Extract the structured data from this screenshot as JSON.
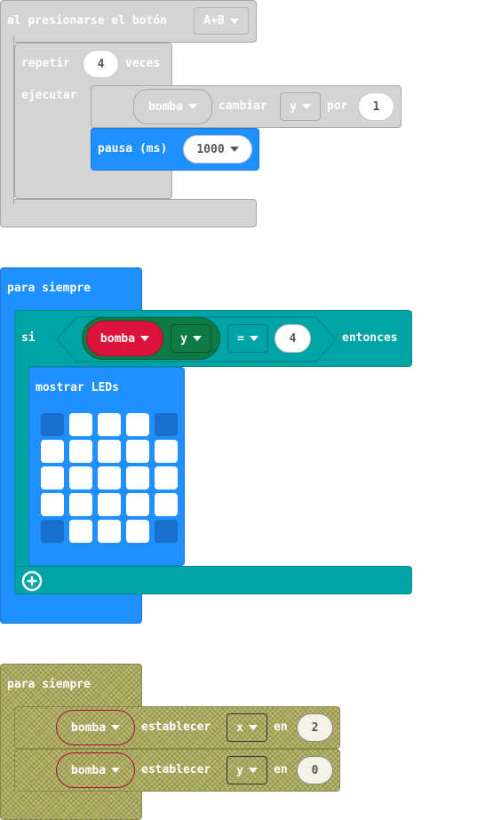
{
  "event_block": {
    "label": "al presionarse el botón",
    "button_value": "A+B",
    "repeat": {
      "label_repeat": "repetir",
      "times": "4",
      "label_times": "veces",
      "label_do": "ejecutar",
      "change": {
        "variable": "bomba",
        "label_change": "cambiar",
        "property": "y",
        "label_by": "por",
        "amount": "1"
      },
      "pause": {
        "label": "pausa (ms)",
        "value": "1000"
      }
    }
  },
  "forever_block_1": {
    "label": "para siempre",
    "if": {
      "label_if": "si",
      "variable": "bomba",
      "property": "y",
      "operator": "=",
      "value": "4",
      "label_then": "entonces"
    },
    "show_leds": {
      "label": "mostrar LEDs",
      "grid": [
        [
          0,
          1,
          1,
          1,
          0
        ],
        [
          1,
          1,
          1,
          1,
          1
        ],
        [
          1,
          1,
          1,
          1,
          1
        ],
        [
          1,
          1,
          1,
          1,
          1
        ],
        [
          0,
          1,
          1,
          1,
          0
        ]
      ]
    },
    "add_icon": "plus-circle-icon"
  },
  "forever_block_2": {
    "label": "para siempre",
    "statements": [
      {
        "variable": "bomba",
        "label_set": "establecer",
        "property": "x",
        "label_to": "en",
        "value": "2"
      },
      {
        "variable": "bomba",
        "label_set": "establecer",
        "property": "y",
        "label_to": "en",
        "value": "0"
      }
    ]
  },
  "colors": {
    "basic": "#1e90ff",
    "logic": "#00a4a6",
    "loops_disabled": "#d4d4d4",
    "sprite": "#dc143c",
    "disabled_pattern": "#b9b76e"
  }
}
